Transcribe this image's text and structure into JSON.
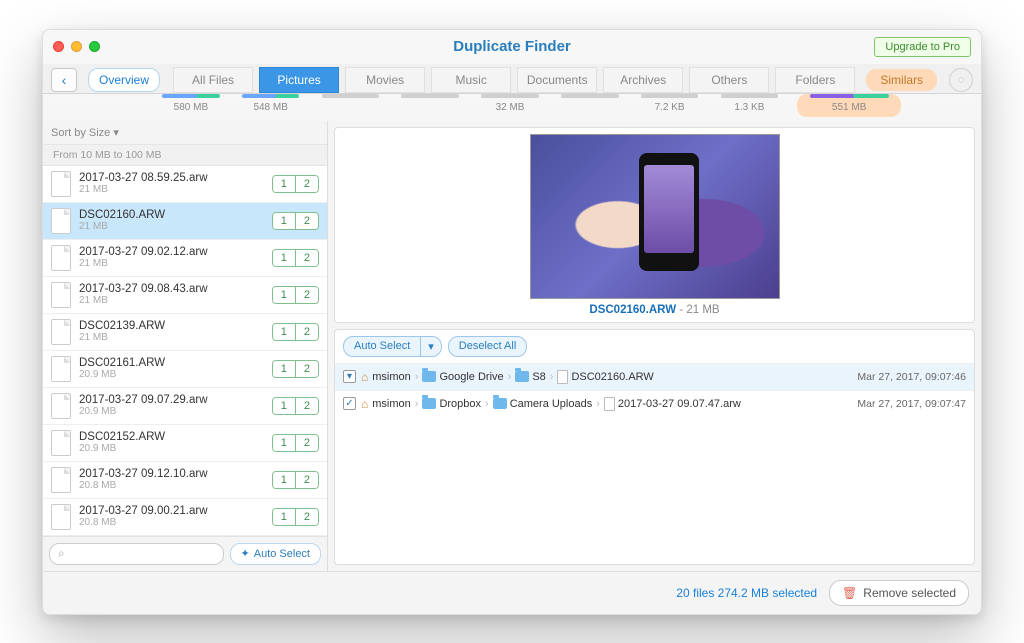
{
  "window": {
    "title": "Duplicate Finder",
    "upgrade_label": "Upgrade to Pro"
  },
  "tabs": {
    "overview": "Overview",
    "items": [
      {
        "label": "All Files",
        "size": "580 MB",
        "gray": false
      },
      {
        "label": "Pictures",
        "size": "548 MB",
        "gray": false,
        "active": true
      },
      {
        "label": "Movies",
        "size": "",
        "gray": true
      },
      {
        "label": "Music",
        "size": "",
        "gray": true
      },
      {
        "label": "Documents",
        "size": "32 MB",
        "gray": true
      },
      {
        "label": "Archives",
        "size": "",
        "gray": true
      },
      {
        "label": "Others",
        "size": "7.2 KB",
        "gray": true
      },
      {
        "label": "Folders",
        "size": "1.3 KB",
        "gray": true
      }
    ],
    "similars": {
      "label": "Similars",
      "size": "551 MB"
    }
  },
  "sort_label": "Sort by Size",
  "section_label": "From 10 MB to 100 MB",
  "files": [
    {
      "name": "2017-03-27 08.59.25.arw",
      "size": "21 MB"
    },
    {
      "name": "DSC02160.ARW",
      "size": "21 MB",
      "selected": true
    },
    {
      "name": "2017-03-27 09.02.12.arw",
      "size": "21 MB"
    },
    {
      "name": "2017-03-27 09.08.43.arw",
      "size": "21 MB"
    },
    {
      "name": "DSC02139.ARW",
      "size": "21 MB"
    },
    {
      "name": "DSC02161.ARW",
      "size": "20.9 MB"
    },
    {
      "name": "2017-03-27 09.07.29.arw",
      "size": "20.9 MB"
    },
    {
      "name": "DSC02152.ARW",
      "size": "20.9 MB"
    },
    {
      "name": "2017-03-27 09.12.10.arw",
      "size": "20.8 MB"
    },
    {
      "name": "2017-03-27 09.00.21.arw",
      "size": "20.8 MB"
    }
  ],
  "pair_labels": {
    "one": "1",
    "two": "2"
  },
  "search_placeholder": "",
  "auto_select_label": "Auto Select",
  "preview": {
    "name": "DSC02160.ARW",
    "sep": " - ",
    "size": "21 MB"
  },
  "detail": {
    "auto_select": "Auto Select",
    "caret": "▾",
    "deselect": "Deselect All",
    "rows": [
      {
        "checked": false,
        "selected": true,
        "crumbs": [
          "msimon",
          "Google Drive",
          "S8"
        ],
        "file": "DSC02160.ARW",
        "date": "Mar 27, 2017, 09:07:46"
      },
      {
        "checked": true,
        "selected": false,
        "crumbs": [
          "msimon",
          "Dropbox",
          "Camera Uploads"
        ],
        "file": "2017-03-27 09.07.47.arw",
        "date": "Mar 27, 2017, 09:07:47"
      }
    ]
  },
  "footer": {
    "status": "20 files 274.2 MB selected",
    "remove": "Remove selected"
  }
}
